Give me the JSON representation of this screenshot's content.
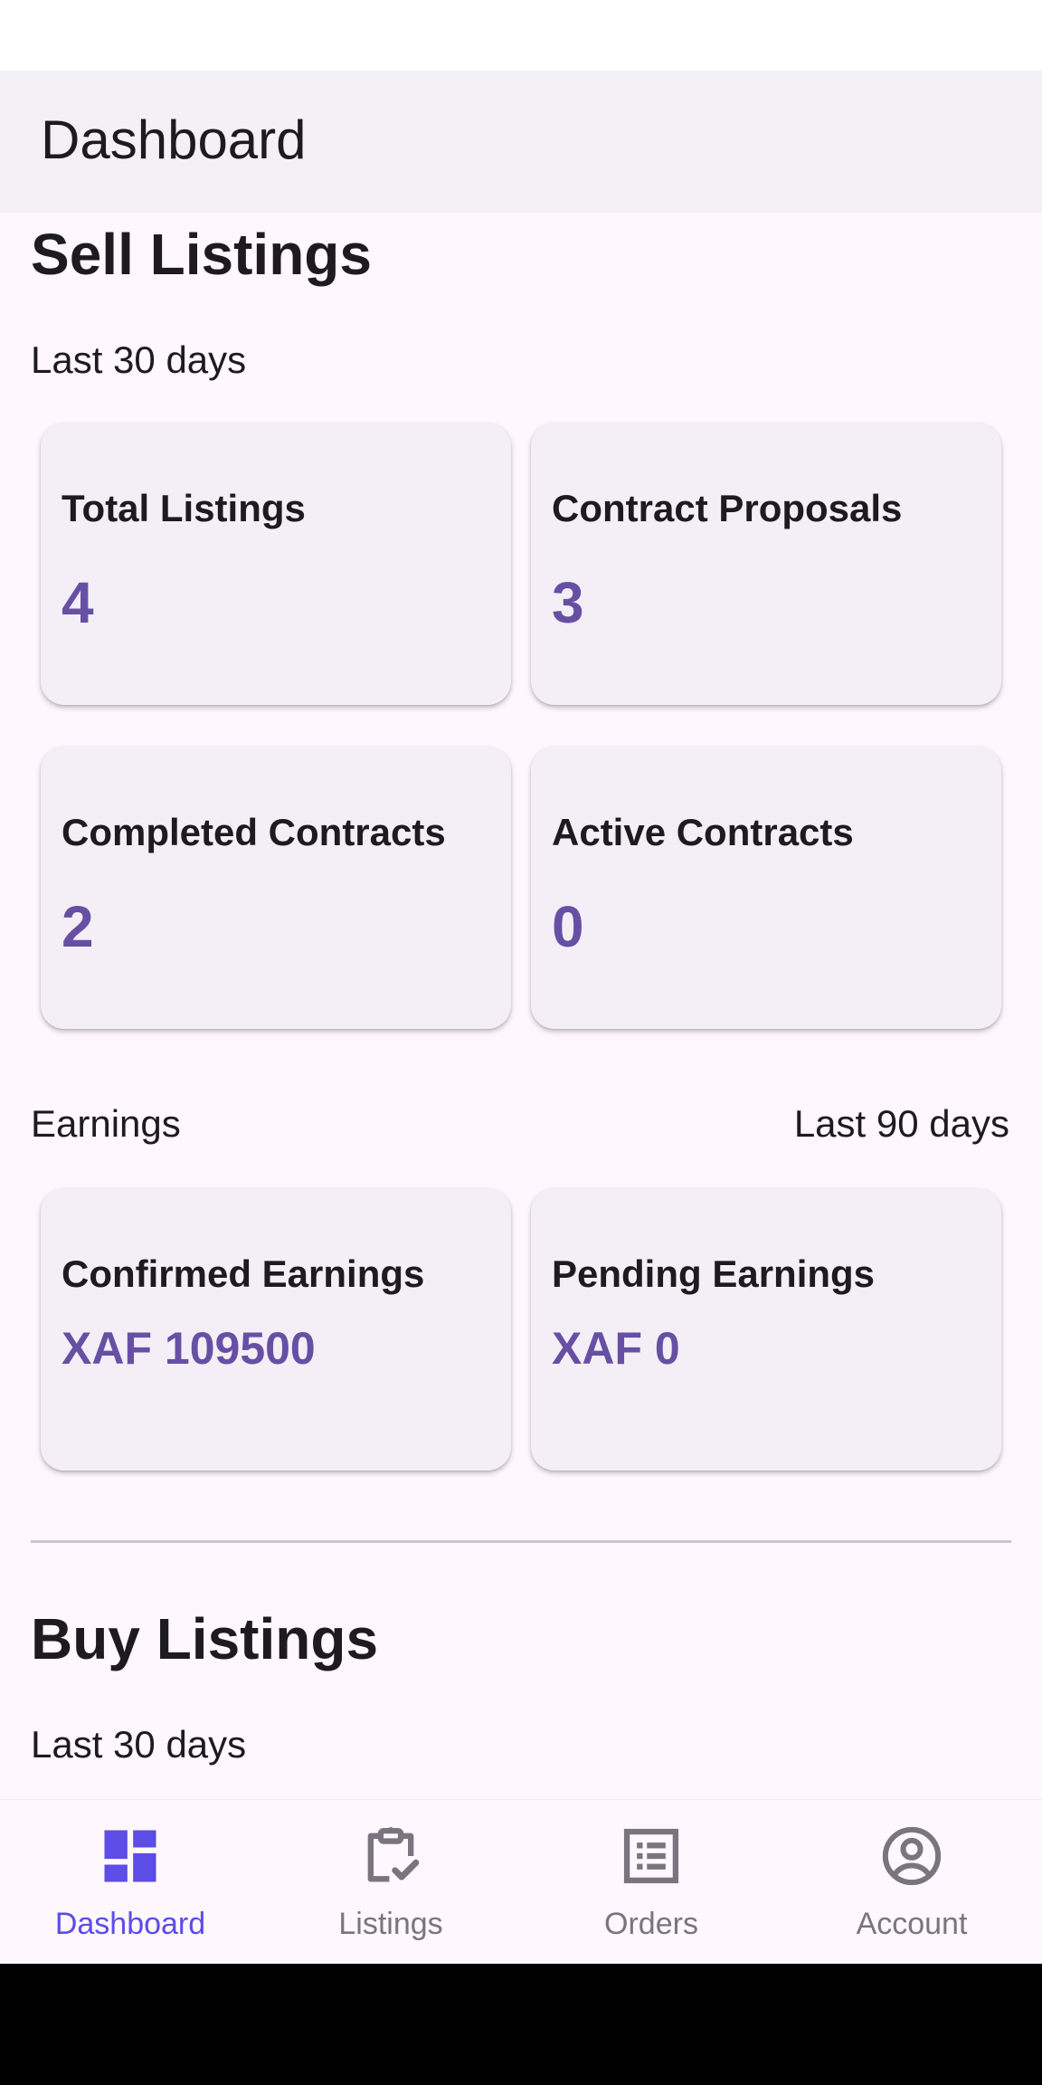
{
  "app_bar": {
    "title": "Dashboard"
  },
  "sell": {
    "heading": "Sell Listings",
    "period": "Last 30 days",
    "cards": [
      {
        "label": "Total Listings",
        "value": "4"
      },
      {
        "label": "Contract Proposals",
        "value": "3"
      },
      {
        "label": "Completed Contracts",
        "value": "2"
      },
      {
        "label": "Active Contracts",
        "value": "0"
      }
    ],
    "earnings": {
      "label": "Earnings",
      "period": "Last 90 days",
      "cards": [
        {
          "label": "Confirmed Earnings",
          "value": "XAF 109500"
        },
        {
          "label": "Pending Earnings",
          "value": "XAF 0"
        }
      ]
    }
  },
  "buy": {
    "heading": "Buy Listings",
    "period": "Last 30 days"
  },
  "bottom_nav": {
    "items": [
      {
        "label": "Dashboard",
        "icon": "dashboard-icon",
        "active": true
      },
      {
        "label": "Listings",
        "icon": "clipboard-check-icon",
        "active": false
      },
      {
        "label": "Orders",
        "icon": "list-icon",
        "active": false
      },
      {
        "label": "Account",
        "icon": "account-circle-icon",
        "active": false
      }
    ]
  },
  "colors": {
    "accent": "#6750a4",
    "nav_active": "#5b4de6",
    "nav_inactive": "#79747e",
    "background": "#fef7fd",
    "card": "#f4eff6"
  }
}
